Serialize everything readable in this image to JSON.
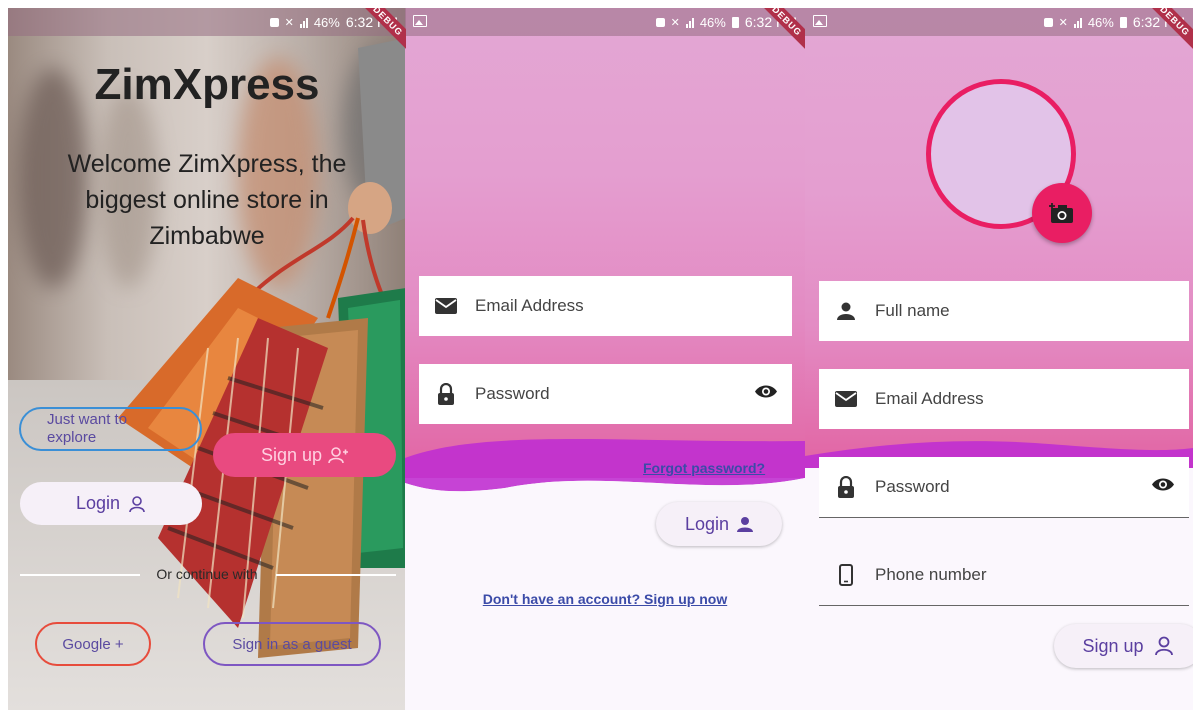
{
  "status_bar": {
    "battery": "46%",
    "time": "6:32 PM",
    "debug": "DEBUG"
  },
  "welcome": {
    "app_name": "ZimXpress",
    "tagline": "Welcome ZimXpress, the biggest online store in Zimbabwe",
    "explore_label": "Just want to explore",
    "signup_label": "Sign up",
    "login_label": "Login",
    "continue_with": "Or continue with",
    "google_label": "Google +",
    "guest_label": "Sign in as a guest"
  },
  "login": {
    "email_placeholder": "Email Address",
    "password_placeholder": "Password",
    "forgot_label": "Forgot password?",
    "login_label": "Login",
    "signup_link": "Don't have an account? Sign up now"
  },
  "signup": {
    "fullname_placeholder": "Full name",
    "email_placeholder": "Email Address",
    "password_placeholder": "Password",
    "phone_placeholder": "Phone number",
    "signup_label": "Sign up"
  },
  "colors": {
    "accent": "#e91e63",
    "pink_top": "#e3a7d4",
    "wave": "#c02fd0",
    "link": "#3b4ba8",
    "label": "#5b3fa0"
  },
  "icons": [
    "mail-icon",
    "lock-icon",
    "eye-icon",
    "person-icon",
    "phone-icon",
    "camera-add-icon",
    "person-add-icon"
  ]
}
